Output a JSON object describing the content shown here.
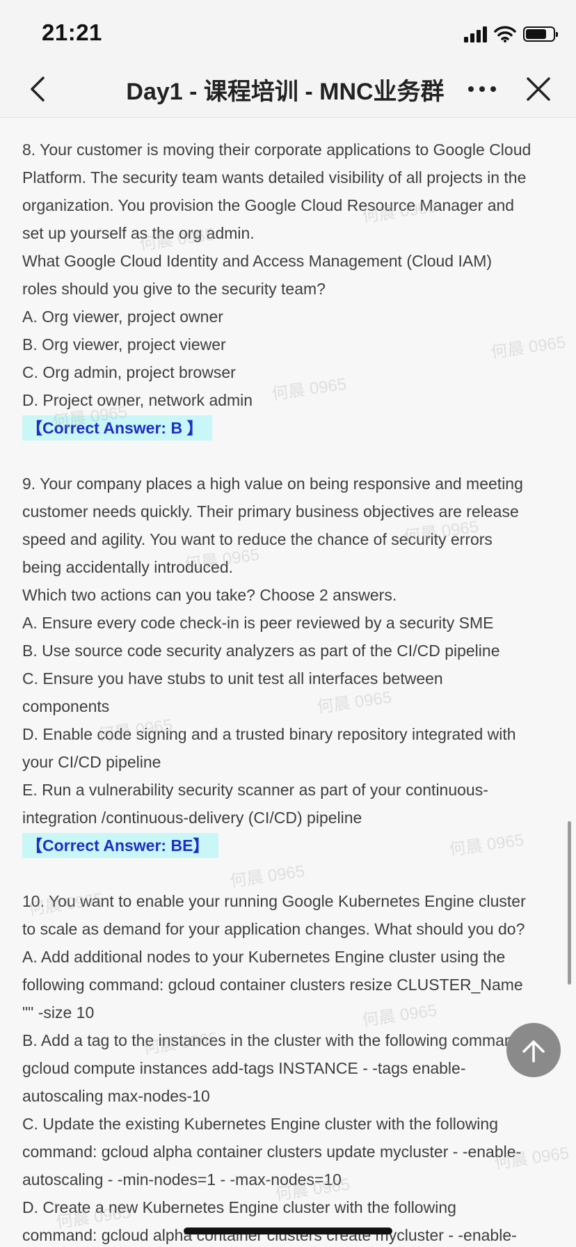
{
  "status_bar": {
    "time": "21:21",
    "signal_icon": "cellular-signal-icon",
    "wifi_icon": "wifi-icon",
    "battery_icon": "battery-icon",
    "battery_level": 0.78
  },
  "nav": {
    "back_icon": "chevron-left-icon",
    "title": "Day1 - 课程培训 - MNC业务群",
    "more_icon": "more-dots-icon",
    "close_icon": "close-icon"
  },
  "watermark_text": "何晨 0965",
  "questions": [
    {
      "lines": [
        "8. Your customer is moving their corporate applications to Google Cloud",
        "Platform. The security team wants detailed visibility of all projects in the",
        "organization. You provision the Google Cloud Resource Manager and",
        "set up yourself as the org admin.",
        "What Google Cloud Identity and Access Management (Cloud IAM)",
        "roles should you give to the security team?",
        "A. Org viewer, project owner",
        "B. Org viewer, project viewer",
        "C. Org admin, project browser",
        "D. Project owner, network admin"
      ],
      "answer": "【Correct Answer: B 】"
    },
    {
      "lines": [
        "9. Your company places a high value on being responsive and meeting",
        "customer needs quickly. Their primary business objectives are release",
        "speed and agility. You want to reduce the chance of security errors",
        "being accidentally introduced.",
        "Which two actions can you take? Choose 2 answers.",
        "A. Ensure every code check-in is peer reviewed by a security SME",
        "B. Use source code security analyzers as part of the CI/CD pipeline",
        "C. Ensure you have stubs to unit test all interfaces between",
        "components",
        "D. Enable code signing and a trusted binary repository integrated with",
        "your CI/CD pipeline",
        "E. Run a vulnerability security scanner as part of your continuous-",
        "integration /continuous-delivery (CI/CD) pipeline"
      ],
      "answer": "【Correct Answer: BE】"
    },
    {
      "lines": [
        "10. You want to enable your running Google Kubernetes Engine cluster",
        "to scale as demand for your application changes. What should you do?",
        "A. Add additional nodes to your Kubernetes Engine cluster using the",
        "following command: gcloud container clusters resize CLUSTER_Name",
        "\"\" -size 10",
        "B. Add a tag to the instances in the cluster with the following command:",
        "gcloud compute instances add-tags INSTANCE - -tags enable-",
        "autoscaling max-nodes-10",
        "C. Update the existing Kubernetes Engine cluster with the following",
        "command: gcloud alpha container clusters update mycluster - -enable-",
        "autoscaling - -min-nodes=1 - -max-nodes=10",
        "D. Create a new Kubernetes Engine cluster with the following",
        "command: gcloud alpha container clusters create mycluster - -enable-"
      ],
      "answer": ""
    }
  ],
  "scroll_top_icon": "arrow-up-icon"
}
